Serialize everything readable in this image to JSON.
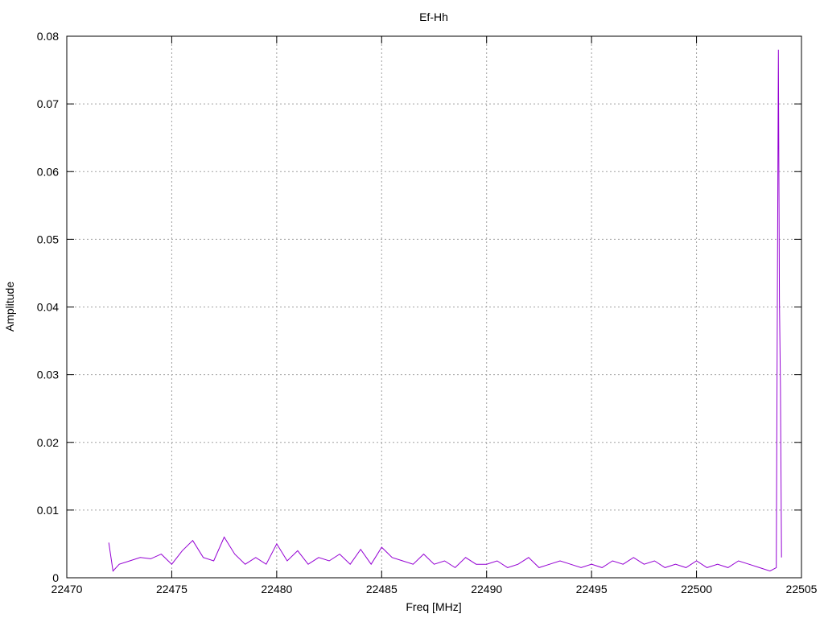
{
  "chart_data": {
    "type": "line",
    "title": "Ef-Hh",
    "xlabel": "Freq [MHz]",
    "ylabel": "Amplitude",
    "xlim": [
      22470,
      22505
    ],
    "ylim": [
      0,
      0.08
    ],
    "xticks": [
      22470,
      22475,
      22480,
      22485,
      22490,
      22495,
      22500,
      22505
    ],
    "xtick_labels": [
      "22470",
      "22475",
      "22480",
      "22485",
      "22490",
      "22495",
      "22500",
      "22505"
    ],
    "yticks": [
      0,
      0.01,
      0.02,
      0.03,
      0.04,
      0.05,
      0.06,
      0.07,
      0.08
    ],
    "ytick_labels": [
      "0",
      "0.01",
      "0.02",
      "0.03",
      "0.04",
      "0.05",
      "0.06",
      "0.07",
      "0.08"
    ],
    "grid": true,
    "legend": "none",
    "colors": {
      "series": "#9400d3",
      "grid": "#a0a0a0",
      "axis": "#000000"
    },
    "series": [
      {
        "x": [
          22472.0,
          22472.2,
          22472.5,
          22473.0,
          22473.5,
          22474.0,
          22474.5,
          22475.0,
          22475.5,
          22476.0,
          22476.5,
          22477.0,
          22477.5,
          22478.0,
          22478.5,
          22479.0,
          22479.5,
          22480.0,
          22480.5,
          22481.0,
          22481.5,
          22482.0,
          22482.5,
          22483.0,
          22483.5,
          22484.0,
          22484.5,
          22485.0,
          22485.5,
          22486.0,
          22486.5,
          22487.0,
          22487.5,
          22488.0,
          22488.5,
          22489.0,
          22489.5,
          22490.0,
          22490.5,
          22491.0,
          22491.5,
          22492.0,
          22492.5,
          22493.0,
          22493.5,
          22494.0,
          22494.5,
          22495.0,
          22495.5,
          22496.0,
          22496.5,
          22497.0,
          22497.5,
          22498.0,
          22498.5,
          22499.0,
          22499.5,
          22500.0,
          22500.5,
          22501.0,
          22501.5,
          22502.0,
          22502.5,
          22503.0,
          22503.5,
          22503.8,
          22503.9,
          22503.95,
          22504.0,
          22504.05
        ],
        "y": [
          0.0052,
          0.001,
          0.002,
          0.0025,
          0.003,
          0.0028,
          0.0035,
          0.002,
          0.004,
          0.0055,
          0.003,
          0.0025,
          0.006,
          0.0035,
          0.002,
          0.003,
          0.002,
          0.005,
          0.0025,
          0.004,
          0.002,
          0.003,
          0.0025,
          0.0035,
          0.002,
          0.0042,
          0.002,
          0.0045,
          0.003,
          0.0025,
          0.002,
          0.0035,
          0.002,
          0.0025,
          0.0015,
          0.003,
          0.002,
          0.002,
          0.0025,
          0.0015,
          0.002,
          0.003,
          0.0015,
          0.002,
          0.0025,
          0.002,
          0.0015,
          0.002,
          0.0015,
          0.0025,
          0.002,
          0.003,
          0.002,
          0.0025,
          0.0015,
          0.002,
          0.0015,
          0.0025,
          0.0015,
          0.002,
          0.0015,
          0.0025,
          0.002,
          0.0015,
          0.001,
          0.0015,
          0.078,
          0.041,
          0.028,
          0.003
        ]
      }
    ]
  }
}
